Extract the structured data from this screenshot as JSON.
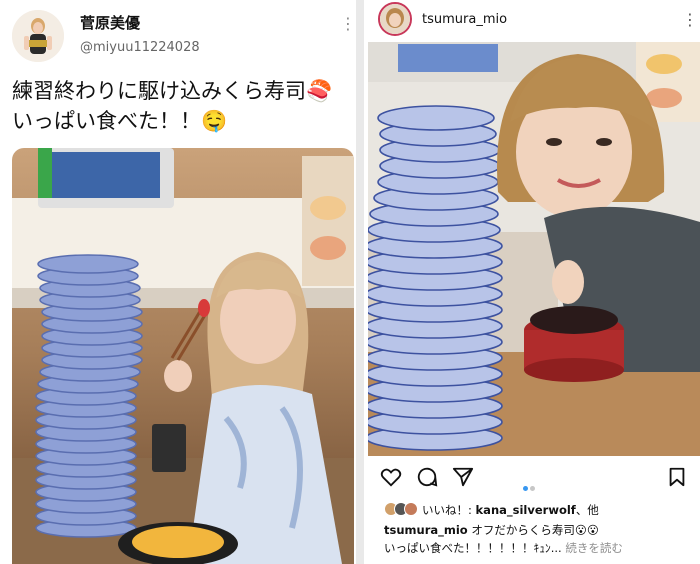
{
  "twitter": {
    "display_name": "菅原美優",
    "handle": "@miyuu11224028",
    "tweet_line1": "練習終わりに駆け込みくら寿司🍣",
    "tweet_line2": "いっぱい食べた！！🤤",
    "more_icon": "vertical-dots-icon"
  },
  "instagram": {
    "username": "tsumura_mio",
    "liked_by_prefix": "いいね！: ",
    "liked_by_user": "kana_silverwolf",
    "liked_by_suffix": "、他",
    "caption_user": "tsumura_mio",
    "caption_text1": " オフだからくら寿司😮😮",
    "caption_text2": "いっぱい食べた！！！！！！ｷｭﾝ...",
    "read_more": "続きを読む",
    "carousel_active_color": "#3897f0",
    "icons": [
      "heart-icon",
      "comment-icon",
      "share-icon",
      "bookmark-icon"
    ]
  }
}
